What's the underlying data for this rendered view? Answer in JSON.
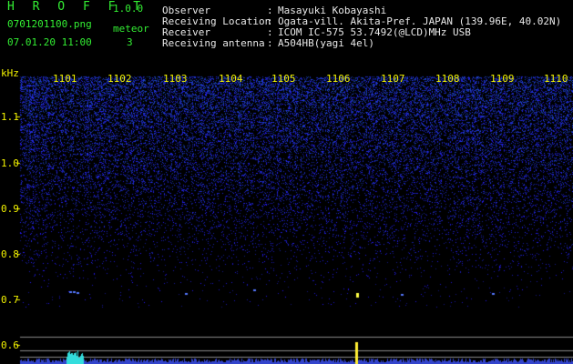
{
  "app": {
    "title": "H R O F F T",
    "version": "1.0.0"
  },
  "file": {
    "name": "0701201100.png",
    "datetime": "07.01.20 11:00"
  },
  "meteor": {
    "label": "meteor",
    "count": "3"
  },
  "station": [
    {
      "key": "Observer",
      "value": "Masayuki Kobayashi"
    },
    {
      "key": "Receiving Location",
      "value": "Ogata-vill. Akita-Pref. JAPAN (139.96E, 40.02N)"
    },
    {
      "key": "Receiver",
      "value": "ICOM IC-575 53.7492(@LCD)MHz USB"
    },
    {
      "key": "Receiving antenna",
      "value": "A504HB(yagi 4el)"
    }
  ],
  "axis": {
    "y_unit": "kHz",
    "y_ticks": [
      "1.1",
      "1.0",
      "0.9",
      "0.8",
      "0.7",
      "0.6"
    ],
    "x_ticks": [
      "1101",
      "1102",
      "1103",
      "1104",
      "1105",
      "1106",
      "1107",
      "1108",
      "1109",
      "1110"
    ]
  },
  "colors": {
    "header_text": "#33ee33",
    "axis_text": "#f2f200",
    "noise": "#2233cc",
    "signal": "#33dddd",
    "meteor": "#ffff44",
    "marker_line": "#888888"
  }
}
